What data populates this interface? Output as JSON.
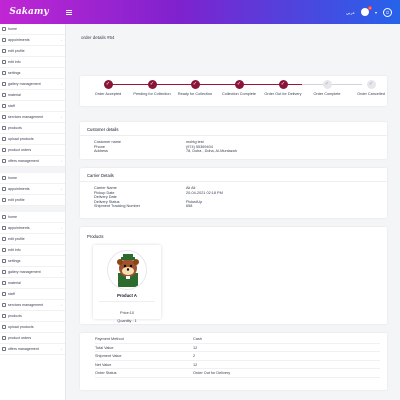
{
  "header": {
    "logo": "Sakamy",
    "lang": "عربي",
    "notif_count": "1",
    "colors": {
      "start": "#c026d3",
      "mid": "#7e22ce",
      "end": "#2563eb"
    }
  },
  "sidebar": {
    "items": [
      {
        "label": "home",
        "icon": "home-icon",
        "chev": false
      },
      {
        "label": "appointments",
        "icon": "calendar-icon",
        "chev": true
      },
      {
        "label": "edit profile",
        "icon": "user-icon",
        "chev": false
      },
      {
        "label": "edit info",
        "icon": "info-icon",
        "chev": false
      },
      {
        "label": "settings",
        "icon": "gear-icon",
        "chev": false
      },
      {
        "label": "gallery management",
        "icon": "image-icon",
        "chev": true
      },
      {
        "label": "material",
        "icon": "box-icon",
        "chev": false
      },
      {
        "label": "staff",
        "icon": "users-icon",
        "chev": false
      },
      {
        "label": "services management",
        "icon": "wrench-icon",
        "chev": true
      },
      {
        "label": "products",
        "icon": "tag-icon",
        "chev": false
      },
      {
        "label": "upload products",
        "icon": "upload-icon",
        "chev": false
      },
      {
        "label": "product orders",
        "icon": "cart-icon",
        "chev": false
      },
      {
        "label": "offers management",
        "icon": "gift-icon",
        "chev": true
      }
    ],
    "items2": [
      {
        "label": "home",
        "icon": "home-icon",
        "chev": false
      },
      {
        "label": "appointments",
        "icon": "calendar-icon",
        "chev": true
      },
      {
        "label": "edit profile",
        "icon": "user-icon",
        "chev": false
      }
    ],
    "items3": [
      {
        "label": "home",
        "icon": "home-icon",
        "chev": false
      },
      {
        "label": "appointments",
        "icon": "calendar-icon",
        "chev": true
      },
      {
        "label": "edit profile",
        "icon": "user-icon",
        "chev": false
      },
      {
        "label": "edit info",
        "icon": "info-icon",
        "chev": false
      },
      {
        "label": "settings",
        "icon": "gear-icon",
        "chev": false
      },
      {
        "label": "gallery management",
        "icon": "image-icon",
        "chev": true
      },
      {
        "label": "material",
        "icon": "box-icon",
        "chev": false
      },
      {
        "label": "staff",
        "icon": "users-icon",
        "chev": false
      },
      {
        "label": "services management",
        "icon": "wrench-icon",
        "chev": true
      },
      {
        "label": "products",
        "icon": "tag-icon",
        "chev": false
      },
      {
        "label": "upload products",
        "icon": "upload-icon",
        "chev": false
      },
      {
        "label": "product orders",
        "icon": "cart-icon",
        "chev": false
      },
      {
        "label": "offers management",
        "icon": "gift-icon",
        "chev": true
      }
    ]
  },
  "page": {
    "title": "order details #54"
  },
  "stepper": {
    "steps": [
      {
        "label": "Order Accepted",
        "done": true
      },
      {
        "label": "Pending for Collection",
        "done": true
      },
      {
        "label": "Ready for Collection",
        "done": true
      },
      {
        "label": "Collection Complete",
        "done": true
      },
      {
        "label": "Order Out for Delivery",
        "done": true
      },
      {
        "label": "Order Complete",
        "done": false
      },
      {
        "label": "Order Cancelled",
        "done": false
      }
    ],
    "done_color": "#8b1538"
  },
  "customer": {
    "title": "Customer details",
    "rows": [
      {
        "k": "Customer name",
        "v": "mohtg test"
      },
      {
        "k": "Phone",
        "v": "(974) 55369404"
      },
      {
        "k": "Address",
        "v": "78, Doha , Doha, Al-Muntazah"
      }
    ]
  },
  "carrier": {
    "title": "Carrier Details",
    "rows": [
      {
        "k": "Carrier Name",
        "v": "Ali Ali"
      },
      {
        "k": "Pickup Date",
        "v": "20-04-2021 02:18 PM"
      },
      {
        "k": "Delivery Date",
        "v": ""
      },
      {
        "k": "Delivery Status",
        "v": "PickedUp"
      },
      {
        "k": "Shipment Tracking Number",
        "v": "658"
      }
    ]
  },
  "products": {
    "title": "Products",
    "items": [
      {
        "name": "Product A",
        "price": "Price:10",
        "qty": "Quantity : 1"
      }
    ]
  },
  "payment": {
    "rows": [
      {
        "k": "Payment Method",
        "v": "Cash"
      },
      {
        "k": "Total Value",
        "v": "12"
      },
      {
        "k": "Shipment Value",
        "v": "2"
      },
      {
        "k": "Net Value",
        "v": "12"
      },
      {
        "k": "Order Status",
        "v": "Order Out for Delivery"
      }
    ]
  }
}
